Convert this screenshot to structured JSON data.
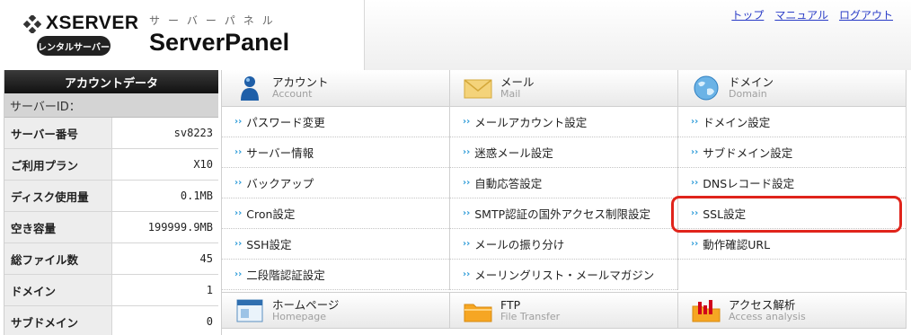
{
  "header": {
    "brand": "XSERVER",
    "rental_badge": "レンタルサーバー",
    "panel_kana": "サーバーパネル",
    "panel_title": "ServerPanel",
    "nav": [
      {
        "label": "トップ"
      },
      {
        "label": "マニュアル"
      },
      {
        "label": "ログアウト"
      }
    ]
  },
  "sidebar": {
    "title": "アカウントデータ",
    "server_id_label": "サーバーID：",
    "rows": [
      {
        "label": "サーバー番号",
        "value": "sv8223"
      },
      {
        "label": "ご利用プラン",
        "value": "X10"
      },
      {
        "label": "ディスク使用量",
        "value": "0.1MB"
      },
      {
        "label": "空き容量",
        "value": "199999.9MB"
      },
      {
        "label": "総ファイル数",
        "value": "45"
      },
      {
        "label": "ドメイン",
        "value": "1"
      },
      {
        "label": "サブドメイン",
        "value": "0"
      }
    ]
  },
  "sections": {
    "account": {
      "title": "アカウント",
      "subtitle": "Account",
      "icon": "user-icon",
      "items": [
        "パスワード変更",
        "サーバー情報",
        "バックアップ",
        "Cron設定",
        "SSH設定",
        "二段階認証設定"
      ]
    },
    "mail": {
      "title": "メール",
      "subtitle": "Mail",
      "icon": "envelope-icon",
      "items": [
        "メールアカウント設定",
        "迷惑メール設定",
        "自動応答設定",
        "SMTP認証の国外アクセス制限設定",
        "メールの振り分け",
        "メーリングリスト・メールマガジン"
      ]
    },
    "domain": {
      "title": "ドメイン",
      "subtitle": "Domain",
      "icon": "globe-icon",
      "items": [
        "ドメイン設定",
        "サブドメイン設定",
        "DNSレコード設定",
        "SSL設定",
        "動作確認URL"
      ]
    },
    "homepage": {
      "title": "ホームページ",
      "subtitle": "Homepage",
      "icon": "webpage-icon"
    },
    "ftp": {
      "title": "FTP",
      "subtitle": "File Transfer",
      "icon": "folder-icon"
    },
    "access": {
      "title": "アクセス解析",
      "subtitle": "Access analysis",
      "icon": "chart-folder-icon"
    }
  },
  "colors": {
    "link": "#2a3cc7",
    "arrow": "#2c9bd8",
    "highlight": "#e0241b"
  }
}
